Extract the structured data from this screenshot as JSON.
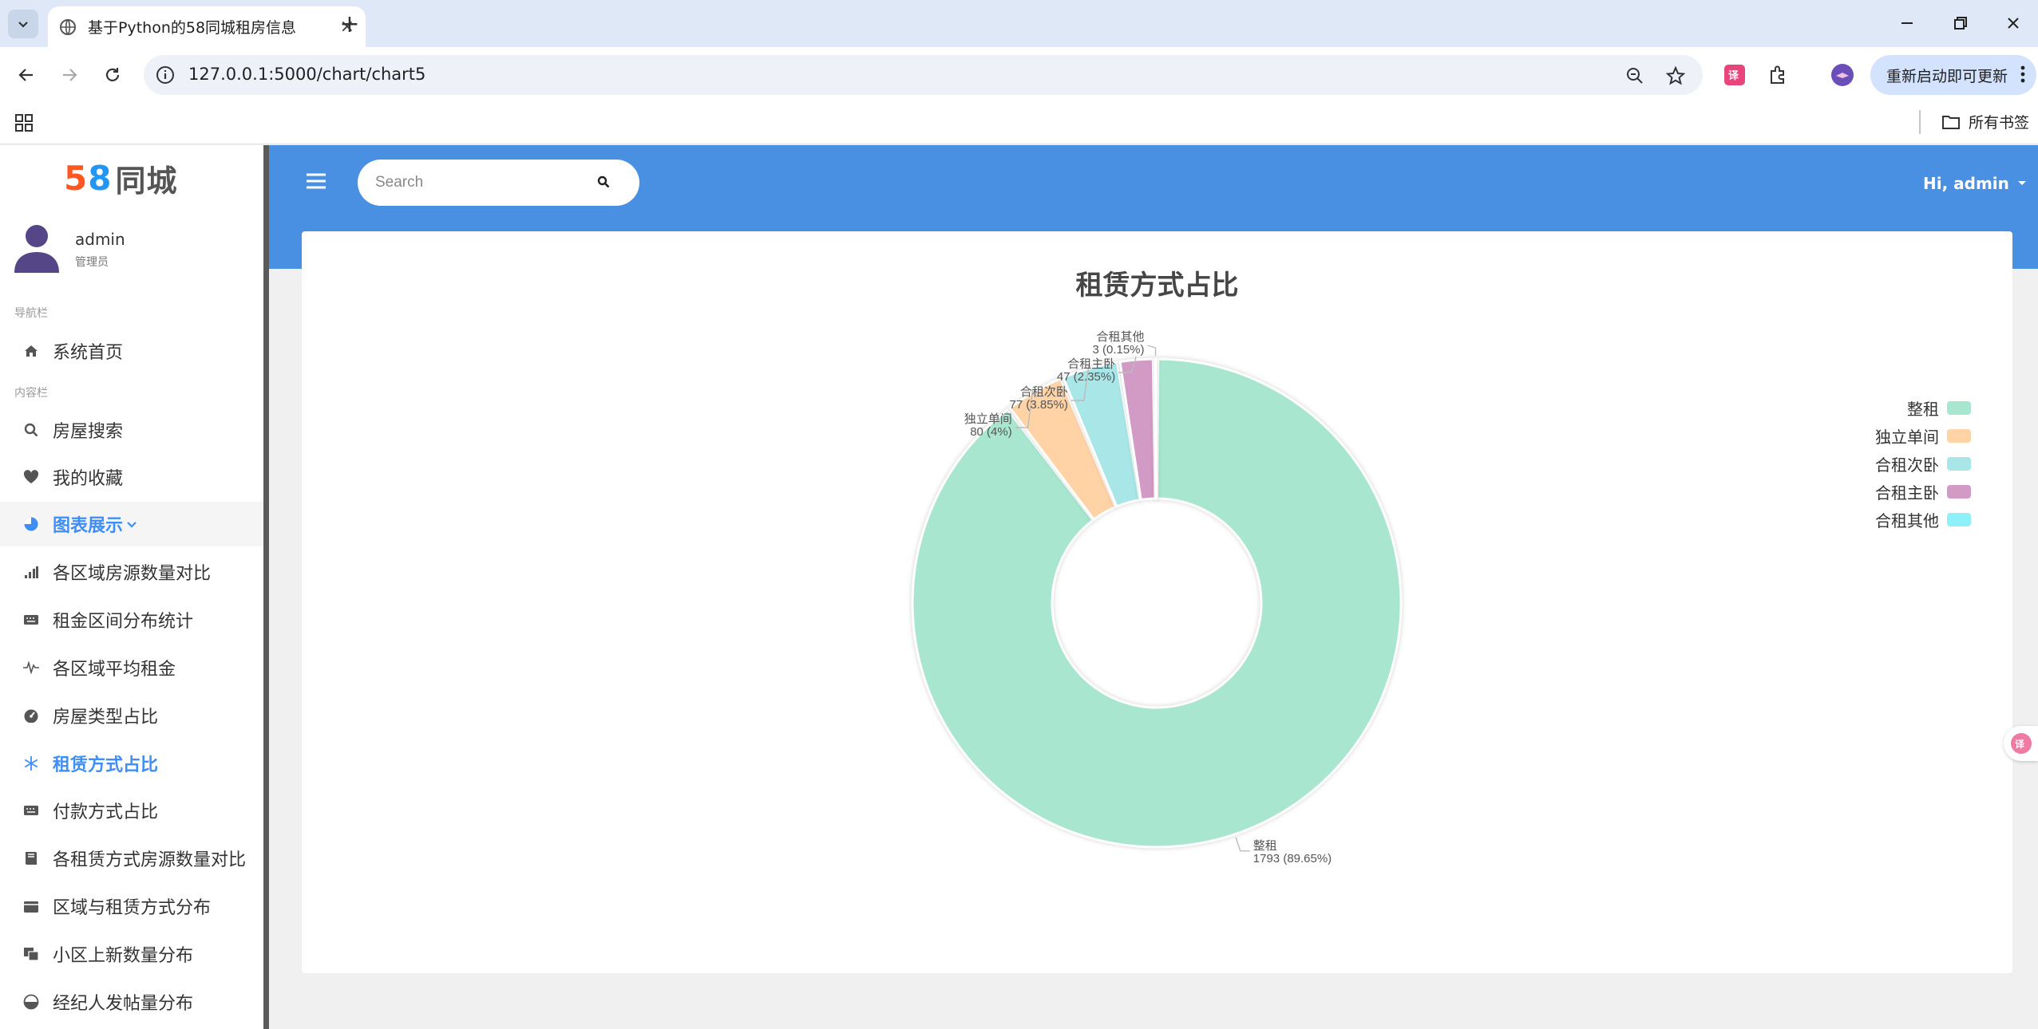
{
  "browser": {
    "tab_title": "基于Python的58同城租房信息",
    "url": "127.0.0.1:5000/chart/chart5",
    "update_label": "重新启动即可更新",
    "all_bookmarks": "所有书签"
  },
  "sidebar": {
    "logo_num1": "5",
    "logo_num2": "8",
    "logo_text": "同城",
    "user_name": "admin",
    "user_role": "管理员",
    "section_nav": "导航栏",
    "section_content": "内容栏",
    "items": [
      {
        "label": "系统首页",
        "icon": "home-icon"
      },
      {
        "label": "房屋搜索",
        "icon": "search-icon"
      },
      {
        "label": "我的收藏",
        "icon": "heart-icon"
      },
      {
        "label": "图表展示",
        "icon": "pie-chart-icon"
      },
      {
        "label": "各区域房源数量对比",
        "icon": "signal-bars-icon"
      },
      {
        "label": "租金区间分布统计",
        "icon": "keyboard-icon"
      },
      {
        "label": "各区域平均租金",
        "icon": "heartbeat-line-icon"
      },
      {
        "label": "房屋类型占比",
        "icon": "gauge-icon"
      },
      {
        "label": "租赁方式占比",
        "icon": "snowflake-icon"
      },
      {
        "label": "付款方式占比",
        "icon": "keyboard-icon"
      },
      {
        "label": "各租赁方式房源数量对比",
        "icon": "book-icon"
      },
      {
        "label": "区域与租赁方式分布",
        "icon": "calendar-icon"
      },
      {
        "label": "小区上新数量分布",
        "icon": "clone-icon"
      },
      {
        "label": "经纪人发帖量分布",
        "icon": "half-circle-icon"
      }
    ]
  },
  "topbar": {
    "search_placeholder": "Search",
    "greeting": "Hi, admin"
  },
  "chart_data": {
    "type": "pie",
    "title": "租赁方式占比",
    "legend_position": "top-right",
    "donut": true,
    "slices": [
      {
        "name": "整租",
        "value": 1793,
        "percent": "89.65%",
        "color": "#a8e6cf"
      },
      {
        "name": "独立单间",
        "value": 80,
        "percent": "4%",
        "color": "#ffd3a5"
      },
      {
        "name": "合租次卧",
        "value": 77,
        "percent": "3.85%",
        "color": "#a8e6e8"
      },
      {
        "name": "合租主卧",
        "value": 47,
        "percent": "2.35%",
        "color": "#d29bc5"
      },
      {
        "name": "合租其他",
        "value": 3,
        "percent": "0.15%",
        "color": "#8ef0f8"
      }
    ]
  },
  "colors": {
    "topbar": "#4a90e2",
    "accent": "#3e8ef7"
  }
}
